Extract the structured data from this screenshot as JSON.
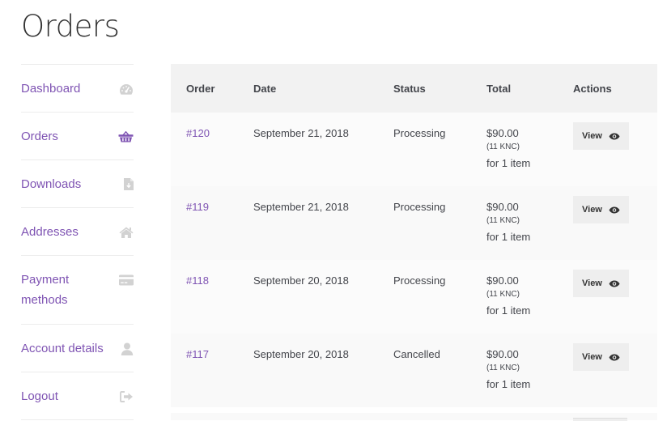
{
  "page": {
    "title": "Orders"
  },
  "nav": {
    "items": [
      {
        "label": "Dashboard",
        "icon": "dashboard-icon"
      },
      {
        "label": "Orders",
        "icon": "basket-icon",
        "active": true
      },
      {
        "label": "Downloads",
        "icon": "file-download-icon"
      },
      {
        "label": "Addresses",
        "icon": "home-icon"
      },
      {
        "label": "Payment methods",
        "icon": "credit-card-icon"
      },
      {
        "label": "Account details",
        "icon": "user-icon"
      },
      {
        "label": "Logout",
        "icon": "sign-out-icon"
      }
    ]
  },
  "orders": {
    "headers": {
      "order": "Order",
      "date": "Date",
      "status": "Status",
      "total": "Total",
      "actions": "Actions"
    },
    "rows": [
      {
        "number": "#120",
        "date": "September 21, 2018",
        "status": "Processing",
        "amount": "$90.00",
        "knc": "(11 KNC)",
        "items": "for 1 item",
        "action": "View"
      },
      {
        "number": "#119",
        "date": "September 21, 2018",
        "status": "Processing",
        "amount": "$90.00",
        "knc": "(11 KNC)",
        "items": "for 1 item",
        "action": "View"
      },
      {
        "number": "#118",
        "date": "September 20, 2018",
        "status": "Processing",
        "amount": "$90.00",
        "knc": "(11 KNC)",
        "items": "for 1 item",
        "action": "View"
      },
      {
        "number": "#117",
        "date": "September 20, 2018",
        "status": "Cancelled",
        "amount": "$90.00",
        "knc": "(11 KNC)",
        "items": "for 1 item",
        "action": "View"
      }
    ]
  },
  "colors": {
    "link": "#7f54b3",
    "text": "#43454b",
    "icon": "#d2d2d2",
    "header_bg": "#f2f2f2",
    "button_bg": "#eeeeee"
  }
}
